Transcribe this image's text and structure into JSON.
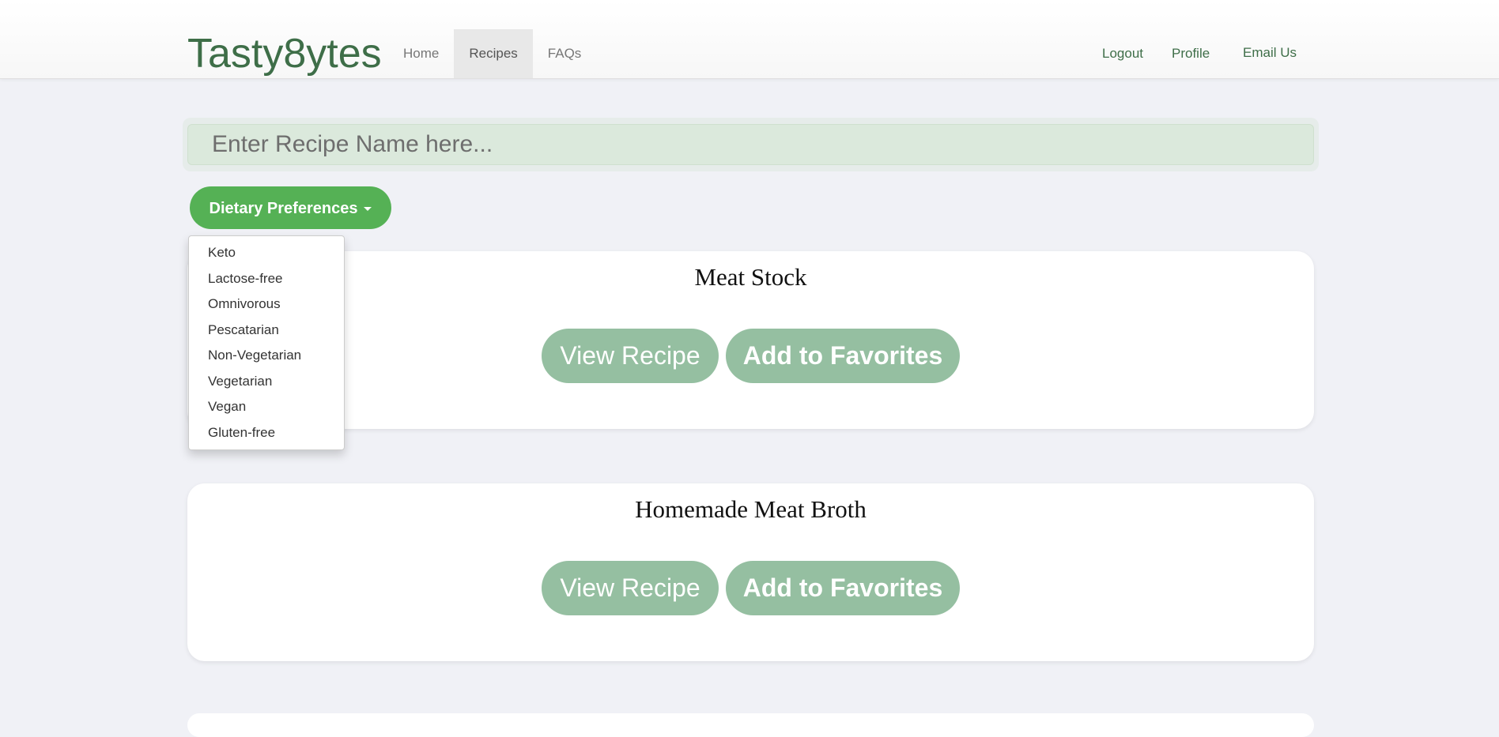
{
  "brand": "Tasty8ytes",
  "nav": {
    "left": [
      "Home",
      "Recipes",
      "FAQs"
    ],
    "active": "Recipes",
    "right": [
      "Logout",
      "Profile",
      "Email Us"
    ]
  },
  "search": {
    "placeholder": "Enter Recipe Name here...",
    "value": ""
  },
  "dietary": {
    "button_label": "Dietary Preferences",
    "options": [
      "Keto",
      "Lactose-free",
      "Omnivorous",
      "Pescatarian",
      "Non-Vegetarian",
      "Vegetarian",
      "Vegan",
      "Gluten-free"
    ]
  },
  "recipes": [
    {
      "title": "Meat Stock",
      "view_label": "View Recipe",
      "fav_label": "Add to Favorites"
    },
    {
      "title": "Homemade Meat Broth",
      "view_label": "View Recipe",
      "fav_label": "Add to Favorites"
    }
  ],
  "colors": {
    "brand": "#3e6e48",
    "primary_button": "#55b155",
    "card_button": "#95bfa1",
    "background": "#f0f1f6",
    "search_bg": "#dbe9dc"
  }
}
